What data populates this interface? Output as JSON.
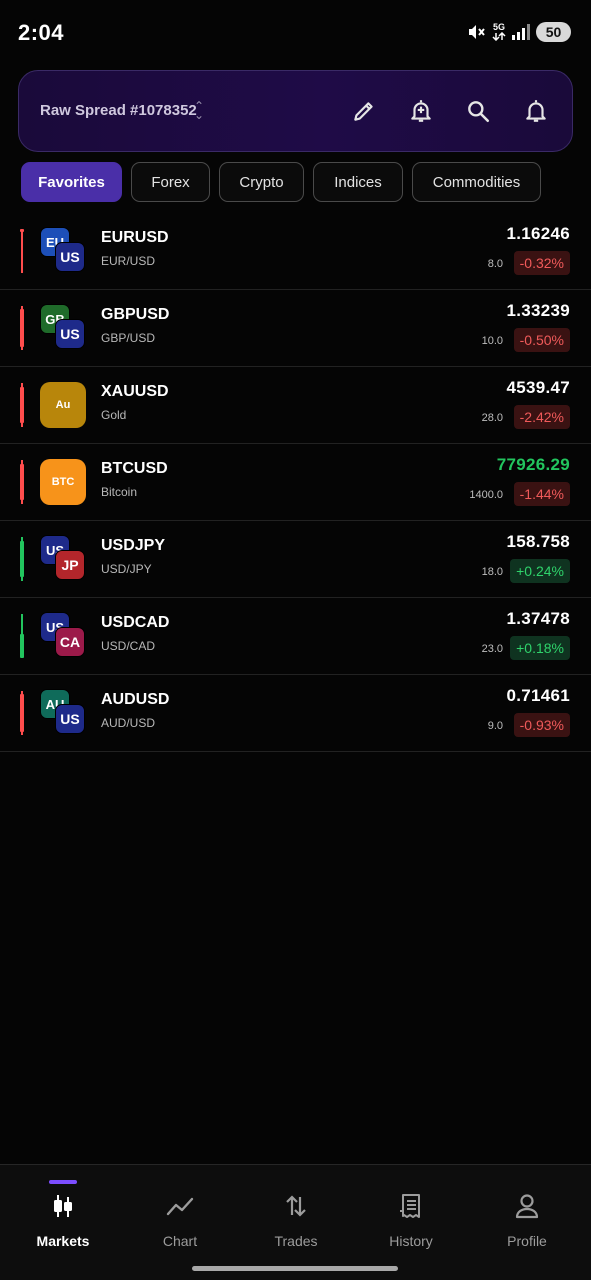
{
  "status_bar": {
    "time": "2:04",
    "network": "5G",
    "battery": "50"
  },
  "account": {
    "name": "Raw Spread #1078352"
  },
  "tabs": [
    {
      "label": "Favorites",
      "active": true
    },
    {
      "label": "Forex",
      "active": false
    },
    {
      "label": "Crypto",
      "active": false
    },
    {
      "label": "Indices",
      "active": false
    },
    {
      "label": "Commodities",
      "active": false
    }
  ],
  "markets": [
    {
      "symbol": "EURUSD",
      "description": "EUR/USD",
      "price": "1.16246",
      "spread": "8.0",
      "change": "-0.32%",
      "direction": "down",
      "flag1": "EU",
      "flag2": "US"
    },
    {
      "symbol": "GBPUSD",
      "description": "GBP/USD",
      "price": "1.33239",
      "spread": "10.0",
      "change": "-0.50%",
      "direction": "down",
      "flag1": "GB",
      "flag2": "US"
    },
    {
      "symbol": "XAUUSD",
      "description": "Gold",
      "price": "4539.47",
      "spread": "28.0",
      "change": "-2.42%",
      "direction": "down",
      "icon": "Au"
    },
    {
      "symbol": "BTCUSD",
      "description": "Bitcoin",
      "price": "77926.29",
      "spread": "1400.0",
      "change": "-1.44%",
      "direction": "down",
      "icon": "BTC"
    },
    {
      "symbol": "USDJPY",
      "description": "USD/JPY",
      "price": "158.758",
      "spread": "18.0",
      "change": "+0.24%",
      "direction": "up",
      "flag1": "US",
      "flag2": "JP"
    },
    {
      "symbol": "USDCAD",
      "description": "USD/CAD",
      "price": "1.37478",
      "spread": "23.0",
      "change": "+0.18%",
      "direction": "up",
      "flag1": "US",
      "flag2": "CA"
    },
    {
      "symbol": "AUDUSD",
      "description": "AUD/USD",
      "price": "0.71461",
      "spread": "9.0",
      "change": "-0.93%",
      "direction": "down",
      "flag1": "AU",
      "flag2": "US"
    }
  ],
  "bottom_nav": [
    {
      "label": "Markets",
      "icon": "candlestick-icon",
      "active": true
    },
    {
      "label": "Chart",
      "icon": "line-chart-icon",
      "active": false
    },
    {
      "label": "Trades",
      "icon": "swap-vertical-icon",
      "active": false
    },
    {
      "label": "History",
      "icon": "receipt-icon",
      "active": false
    },
    {
      "label": "Profile",
      "icon": "person-icon",
      "active": false
    }
  ],
  "colors": {
    "accent": "#4a2fa8",
    "positive": "#22c55e",
    "negative": "#f05a5a",
    "background": "#050505"
  }
}
